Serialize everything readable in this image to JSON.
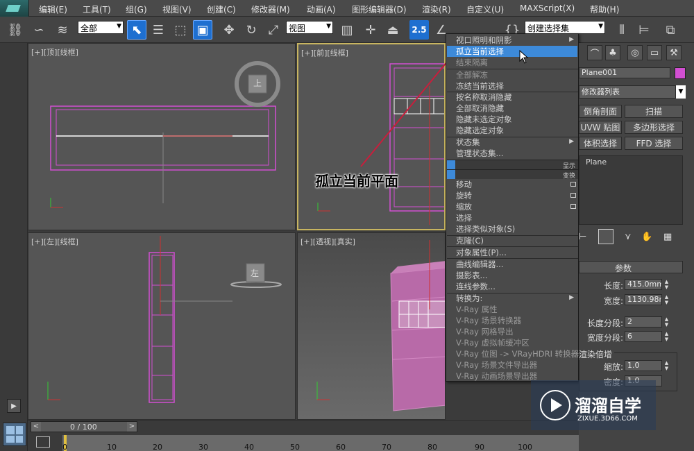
{
  "menubar": {
    "items": [
      "编辑(E)",
      "工具(T)",
      "组(G)",
      "视图(V)",
      "创建(C)",
      "修改器(M)",
      "动画(A)",
      "图形编辑器(D)",
      "渲染(R)",
      "自定义(U)",
      "MAXScript(X)",
      "帮助(H)"
    ]
  },
  "toolbar": {
    "filter_select": "全部",
    "coord_select": "视图",
    "snap_value": "2.5",
    "named_selection": "创建选择集"
  },
  "viewports": {
    "top": {
      "label": "[+][顶][线框]",
      "cube_label": "上"
    },
    "front": {
      "label": "[+][前][线框]"
    },
    "left": {
      "label": "[+][左][线框]",
      "cube_label": "左"
    },
    "persp": {
      "label": "[+][透视][真实]"
    }
  },
  "context_menu": {
    "items": [
      "视口照明和阴影",
      "孤立当前选择",
      "结束隔离",
      "全部解冻",
      "冻结当前选择",
      "按名称取消隐藏",
      "全部取消隐藏",
      "隐藏未选定对象",
      "隐藏选定对象",
      "状态集",
      "管理状态集...",
      "移动",
      "旋转",
      "缩放",
      "选择",
      "选择类似对象(S)",
      "克隆(C)",
      "对象属性(P)...",
      "曲线编辑器...",
      "摄影表...",
      "连线参数...",
      "转换为:",
      "V-Ray 属性",
      "V-Ray 场景转换器",
      "V-Ray 网格导出",
      "V-Ray 虚拟帧缓冲区",
      "V-Ray 位图 -> VRayHDRI 转换器",
      "V-Ray 场景文件导出器",
      "V-Ray 动画场景导出器"
    ],
    "display_bar": "显示",
    "transform_bar": "变换"
  },
  "annotation": "孤立当前平面",
  "command_panel": {
    "object_name": "Plane001",
    "modifier_list": "修改器列表",
    "buttons": [
      "倒角剖面",
      "扫描",
      "UVW 贴图",
      "多边形选择",
      "体积选择",
      "FFD 选择"
    ],
    "stack_item": "Plane",
    "params_title": "参数",
    "length_label": "长度:",
    "length_value": "415.0mm",
    "width_label": "宽度:",
    "width_value": "1130.98m",
    "length_segs_label": "长度分段:",
    "length_segs_value": "2",
    "width_segs_label": "宽度分段:",
    "width_segs_value": "6",
    "render_mult_label": "渲染倍增",
    "scale_label": "缩放:",
    "scale_value": "1.0",
    "density_label": "密度:",
    "density_value": "1.0"
  },
  "timeline": {
    "frame_text": "0 / 100",
    "ticks": [
      "0",
      "10",
      "20",
      "30",
      "40",
      "50",
      "60",
      "70",
      "80",
      "90",
      "100"
    ]
  },
  "watermark": {
    "title": "溜溜自学",
    "url": "ZIXUE.3D66.COM"
  },
  "colors": {
    "object_wire": "#d24fd2",
    "highlight": "#3d8ad9",
    "active_viewport_border": "#c8b560"
  }
}
